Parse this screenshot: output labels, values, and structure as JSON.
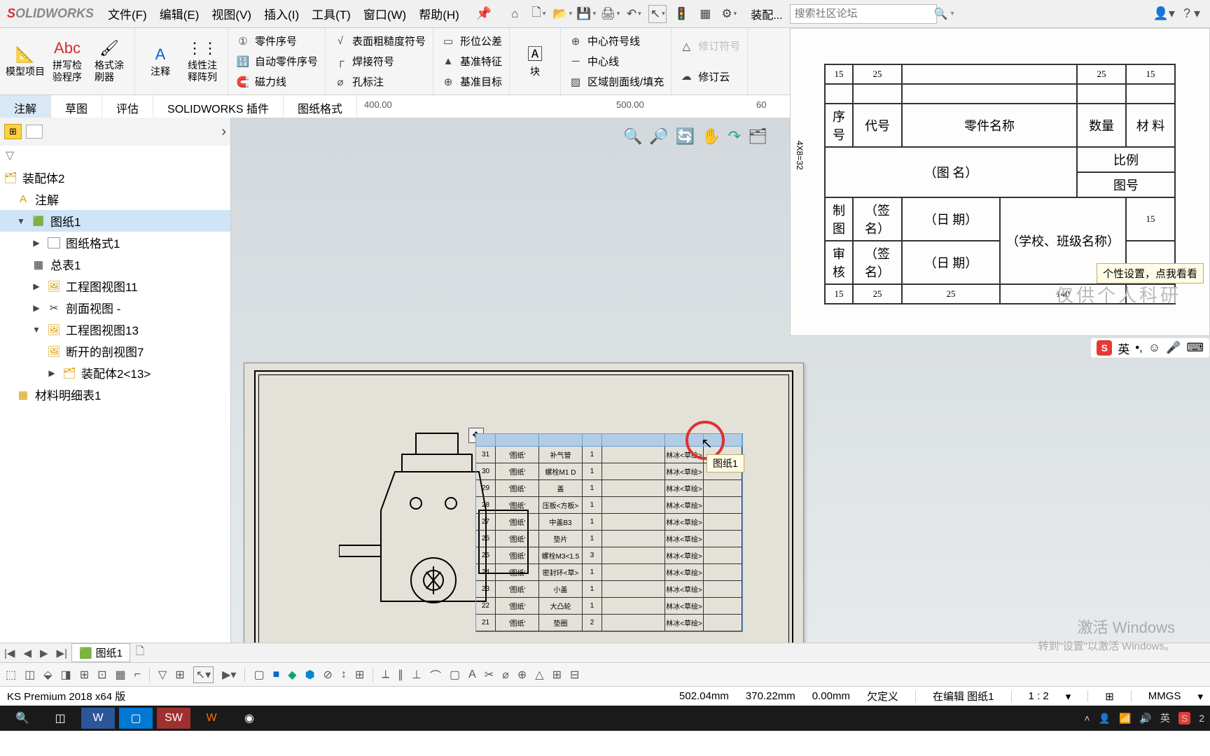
{
  "app": {
    "logo_s": "S",
    "logo_rest": "OLIDWORKS"
  },
  "menu": {
    "file": "文件(F)",
    "edit": "编辑(E)",
    "view": "视图(V)",
    "insert": "插入(I)",
    "tools": "工具(T)",
    "window": "窗口(W)",
    "help": "帮助(H)"
  },
  "top_icons": {
    "assembly": "装配..."
  },
  "search": {
    "placeholder": "搜索社区论坛"
  },
  "ribbon": {
    "g1": {
      "model_items": "模型项目",
      "spell": "拼写检\n验程序",
      "fmt": "格式涂\n刷器",
      "note": "注释",
      "linpat": "线性注\n释阵列"
    },
    "g2": {
      "partno": "零件序号",
      "autopartno": "自动零件序号",
      "magline": "磁力线"
    },
    "g3": {
      "surf": "表面粗糙度符号",
      "weld": "焊接符号",
      "hole": "孔标注"
    },
    "g4": {
      "geotol": "形位公差",
      "datum": "基准特征",
      "dtarget": "基准目标"
    },
    "g5": {
      "block": "块"
    },
    "g6": {
      "centermark": "中心符号线",
      "centerline": "中心线",
      "hatch": "区域剖面线/填充"
    },
    "g7": {
      "revsym": "修订符号",
      "revcloud": "修订云"
    }
  },
  "tabs": {
    "annotate": "注解",
    "sketch": "草图",
    "evaluate": "评估",
    "swaddin": "SOLIDWORKS 插件",
    "sheetfmt": "图纸格式"
  },
  "ruler": {
    "t400": "400.00",
    "t500": "500.00",
    "t60": "60"
  },
  "tree": {
    "root": "装配体2",
    "annotation": "注解",
    "sheet": "图纸1",
    "format": "图纸格式1",
    "maintable": "总表1",
    "view11": "工程图视图11",
    "secview": "剖面视图 -",
    "view13": "工程图视图13",
    "break7": "断开的剖视图7",
    "asm13": "装配体2<13>",
    "bom": "材料明细表1"
  },
  "tooltip_sheet": "图纸1",
  "bom_rows": [
    {
      "n": "31",
      "a": "'图纸'",
      "b": "补气管",
      "c": "1",
      "d": "",
      "e": "林冰<草绘>"
    },
    {
      "n": "30",
      "a": "'图纸'",
      "b": "螺栓M1 D",
      "c": "1",
      "d": "",
      "e": "林冰<草绘>"
    },
    {
      "n": "29",
      "a": "'图纸'",
      "b": "盖",
      "c": "1",
      "d": "",
      "e": "林冰<草绘>"
    },
    {
      "n": "28",
      "a": "'图纸'",
      "b": "压板<方板>",
      "c": "1",
      "d": "",
      "e": "林冰<草绘>"
    },
    {
      "n": "27",
      "a": "'图纸'",
      "b": "中盖B3",
      "c": "1",
      "d": "",
      "e": "林冰<草绘>"
    },
    {
      "n": "26",
      "a": "'图纸'",
      "b": "垫片",
      "c": "1",
      "d": "",
      "e": "林冰<草绘>"
    },
    {
      "n": "25",
      "a": "'图纸'",
      "b": "螺栓M3<1.5",
      "c": "3",
      "d": "",
      "e": "林冰<草绘>"
    },
    {
      "n": "24",
      "a": "'图纸'",
      "b": "密封环<草>",
      "c": "1",
      "d": "",
      "e": "林冰<草绘>"
    },
    {
      "n": "23",
      "a": "'图纸'",
      "b": "小盖",
      "c": "1",
      "d": "",
      "e": "林冰<草绘>"
    },
    {
      "n": "22",
      "a": "'图纸'",
      "b": "大凸轮",
      "c": "1",
      "d": "",
      "e": "林冰<草绘>"
    },
    {
      "n": "21",
      "a": "'图纸'",
      "b": "垫圈",
      "c": "2",
      "d": "",
      "e": "林冰<草绘>"
    }
  ],
  "ref": {
    "dims_top": [
      "15",
      "25",
      "",
      "25",
      "15"
    ],
    "side": "4X8=32",
    "row_header": [
      "序号",
      "代号",
      "零件名称",
      "数量",
      "材 料"
    ],
    "title_cell": "（图   名）",
    "ratio": "比例",
    "sheetnum": "图号",
    "drawn": "制图",
    "check": "审核",
    "sign": "（签 名）",
    "date": "（日 期）",
    "school": "（学校、班级名称）",
    "bottom_dims": [
      "15",
      "25",
      "25"
    ],
    "total_w": "140",
    "tip": "个性设置，点我看看",
    "watermark": "仅供个人科研"
  },
  "sogou": {
    "lang": "英",
    "punct": "•,"
  },
  "sheettab": {
    "name": "图纸1"
  },
  "status": {
    "version": "KS Premium 2018 x64 版",
    "x": "502.04mm",
    "y": "370.22mm",
    "z": "0.00mm",
    "under": "欠定义",
    "editing": "在编辑 图纸1",
    "scale": "1 : 2",
    "units": "MMGS"
  },
  "winact": {
    "l1": "激活 Windows",
    "l2": "转到\"设置\"以激活 Windows。"
  },
  "taskbar": {
    "time": "2"
  }
}
